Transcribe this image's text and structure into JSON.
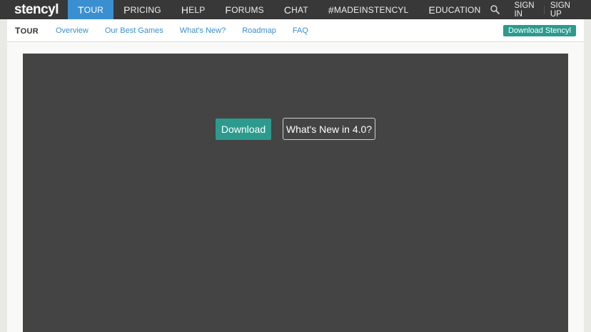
{
  "topnav": {
    "logo": "stencyl",
    "items": [
      {
        "first": "T",
        "rest": "OUR",
        "active": true
      },
      {
        "first": "P",
        "rest": "RICING",
        "active": false
      },
      {
        "first": "H",
        "rest": "ELP",
        "active": false
      },
      {
        "first": "F",
        "rest": "ORUMS",
        "active": false
      },
      {
        "first": "C",
        "rest": "HAT",
        "active": false
      },
      {
        "first": "#",
        "rest": "MADEINSTENCYL",
        "active": false
      },
      {
        "first": "E",
        "rest": "DUCATION",
        "active": false
      }
    ],
    "search_icon": "search-icon",
    "sign_in": "SIGN IN",
    "sign_up": "SIGN UP"
  },
  "subnav": {
    "title_first": "T",
    "title_rest": "OUR",
    "links": [
      "Overview",
      "Our Best Games",
      "What's New?",
      "Roadmap",
      "FAQ"
    ],
    "download_button": "Download Stencyl"
  },
  "hero": {
    "download_button": "Download",
    "whats_new_button": "What's New in 4.0?"
  },
  "colors": {
    "topbar": "#383838",
    "active_tab": "#3a8fd1",
    "teal": "#2c9b8e",
    "hero_bg": "#444444",
    "link": "#3a8fd1"
  }
}
